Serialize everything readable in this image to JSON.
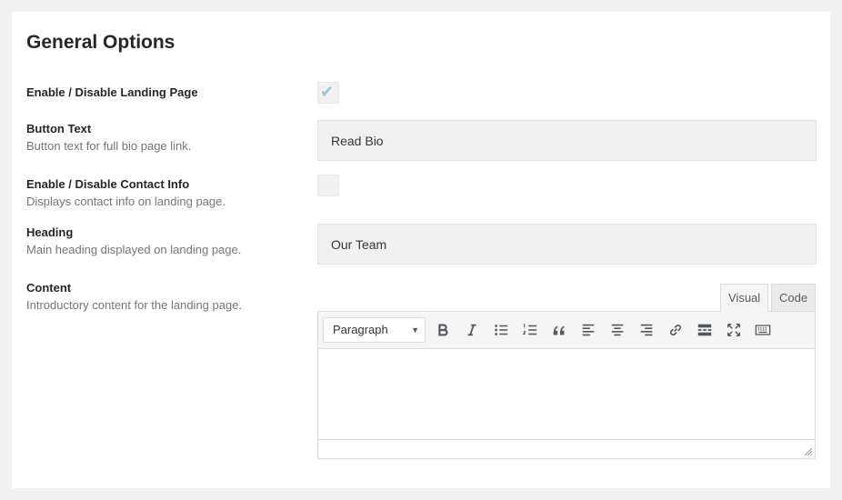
{
  "page": {
    "title": "General Options"
  },
  "fields": {
    "landing": {
      "label": "Enable / Disable Landing Page",
      "checked": true
    },
    "button_text": {
      "label": "Button Text",
      "description": "Button text for full bio page link.",
      "value": "Read Bio"
    },
    "contact": {
      "label": "Enable / Disable Contact Info",
      "description": "Displays contact info on landing page.",
      "checked": false
    },
    "heading": {
      "label": "Heading",
      "description": "Main heading displayed on landing page.",
      "value": "Our Team"
    },
    "content": {
      "label": "Content",
      "description": "Introductory content for the landing page."
    }
  },
  "editor": {
    "tabs": {
      "visual": "Visual",
      "code": "Code"
    },
    "active_tab": "Visual",
    "format": "Paragraph",
    "toolbar_icons": [
      "bold-icon",
      "italic-icon",
      "bullet-list-icon",
      "numbered-list-icon",
      "blockquote-icon",
      "align-left-icon",
      "align-center-icon",
      "align-right-icon",
      "link-icon",
      "read-more-icon",
      "fullscreen-icon",
      "keyboard-icon"
    ]
  },
  "colors": {
    "check": "#9ec3db",
    "field_bg": "#f1f1f1",
    "heading": "#23282d",
    "muted": "#72777c"
  }
}
